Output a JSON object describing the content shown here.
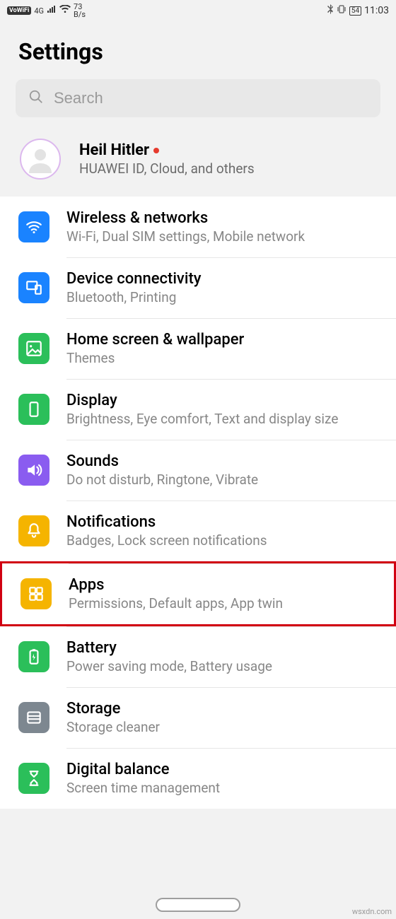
{
  "status": {
    "vowifi": "VoWiFi",
    "net": "4G",
    "speed_num": "73",
    "speed_unit": "B/s",
    "battery": "54",
    "time": "11:03"
  },
  "header": {
    "title": "Settings"
  },
  "search": {
    "placeholder": "Search"
  },
  "account": {
    "name": "Heil Hitler",
    "subtitle": "HUAWEI ID, Cloud, and others"
  },
  "items": [
    {
      "title": "Wireless & networks",
      "subtitle": "Wi-Fi, Dual SIM settings, Mobile network",
      "color": "#1a83ff",
      "icon": "wifi"
    },
    {
      "title": "Device connectivity",
      "subtitle": "Bluetooth, Printing",
      "color": "#1a83ff",
      "icon": "devices"
    },
    {
      "title": "Home screen & wallpaper",
      "subtitle": "Themes",
      "color": "#2bbf5a",
      "icon": "image"
    },
    {
      "title": "Display",
      "subtitle": "Brightness, Eye comfort, Text and display size",
      "color": "#2bbf5a",
      "icon": "phone"
    },
    {
      "title": "Sounds",
      "subtitle": "Do not disturb, Ringtone, Vibrate",
      "color": "#8a5cf0",
      "icon": "sound"
    },
    {
      "title": "Notifications",
      "subtitle": "Badges, Lock screen notifications",
      "color": "#f5b400",
      "icon": "bell"
    },
    {
      "title": "Apps",
      "subtitle": "Permissions, Default apps, App twin",
      "color": "#f5b400",
      "icon": "apps",
      "highlight": true
    },
    {
      "title": "Battery",
      "subtitle": "Power saving mode, Battery usage",
      "color": "#2bbf5a",
      "icon": "battery"
    },
    {
      "title": "Storage",
      "subtitle": "Storage cleaner",
      "color": "#7d8790",
      "icon": "storage"
    },
    {
      "title": "Digital balance",
      "subtitle": "Screen time management",
      "color": "#2bbf5a",
      "icon": "hourglass"
    }
  ],
  "watermark": "wsxdn.com"
}
